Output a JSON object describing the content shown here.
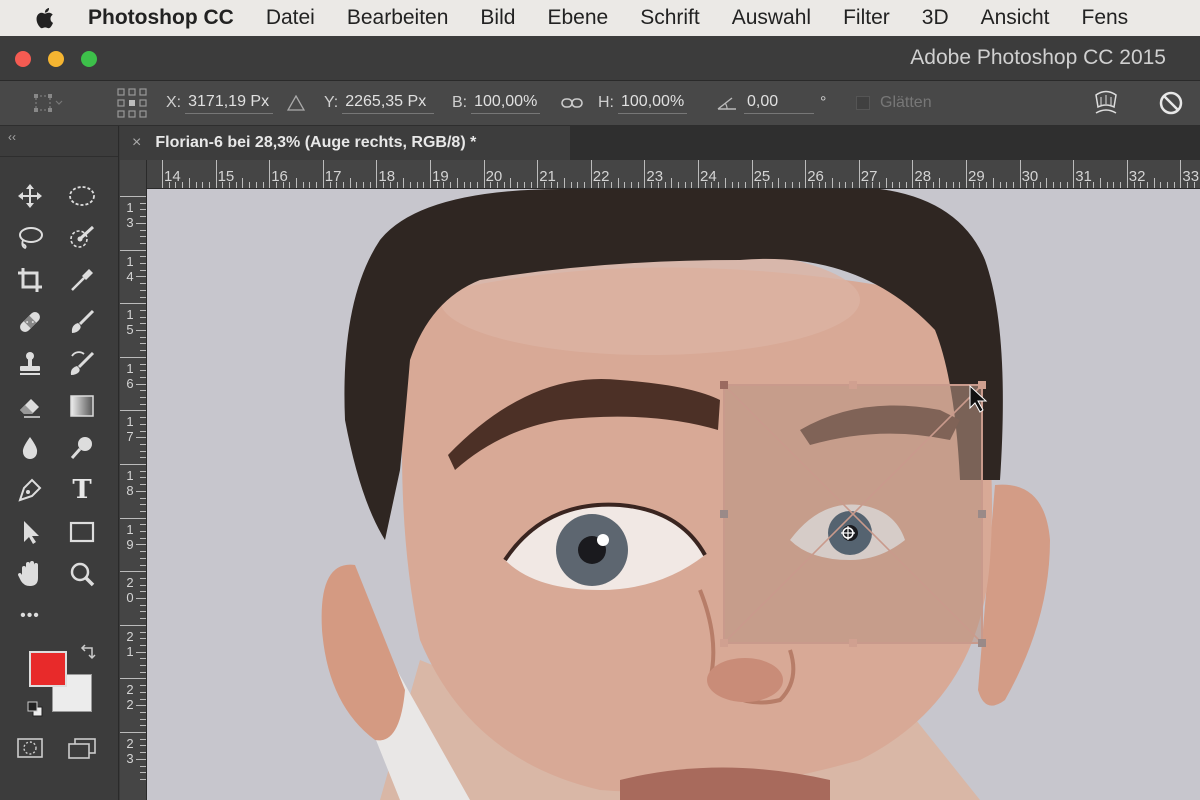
{
  "menubar": {
    "apple_icon": "apple-logo-icon",
    "items": [
      "Photoshop CC",
      "Datei",
      "Bearbeiten",
      "Bild",
      "Ebene",
      "Schrift",
      "Auswahl",
      "Filter",
      "3D",
      "Ansicht",
      "Fens"
    ]
  },
  "window": {
    "title": "Adobe Photoshop CC 2015"
  },
  "options": {
    "x_label": "X:",
    "x_value": "3171,19 Px",
    "y_label": "Y:",
    "y_value": "2265,35 Px",
    "b_label": "B:",
    "b_value": "100,00%",
    "h_label": "H:",
    "h_value": "100,00%",
    "angle_value": "0,00",
    "angle_unit": "°",
    "smooth_label": "Glätten"
  },
  "document": {
    "tab_title": "Florian-6 bei 28,3% (Auge rechts, RGB/8) *",
    "close_symbol": "×"
  },
  "ruler": {
    "top_numbers": [
      "14",
      "15",
      "16",
      "17",
      "18",
      "19",
      "20",
      "21",
      "22",
      "23",
      "24",
      "25",
      "26",
      "27",
      "28",
      "29",
      "30",
      "31",
      "32",
      "33"
    ],
    "left_numbers": [
      [
        "1",
        "3"
      ],
      [
        "1",
        "4"
      ],
      [
        "1",
        "5"
      ],
      [
        "1",
        "6"
      ],
      [
        "1",
        "7"
      ],
      [
        "1",
        "8"
      ],
      [
        "1",
        "9"
      ],
      [
        "2",
        "0"
      ],
      [
        "2",
        "1"
      ],
      [
        "2",
        "2"
      ],
      [
        "2",
        "3"
      ]
    ]
  },
  "tools": [
    "move-tool",
    "ellipse-marquee-tool",
    "lasso-tool",
    "quick-selection-tool",
    "crop-tool",
    "eyedropper-tool",
    "healing-brush-tool",
    "brush-tool",
    "clone-stamp-tool",
    "history-brush-tool",
    "eraser-tool",
    "gradient-tool",
    "blur-tool",
    "dodge-tool",
    "pen-tool",
    "type-tool",
    "path-selection-tool",
    "rectangle-tool",
    "hand-tool",
    "zoom-tool",
    "more-tools"
  ],
  "type_tool_glyph": "T",
  "more_glyph": "•••",
  "colors": {
    "foreground": "#e82a2a",
    "background": "#ececec",
    "canvas_bg": "#c6c5cc",
    "transform_frame": "#c89888"
  }
}
